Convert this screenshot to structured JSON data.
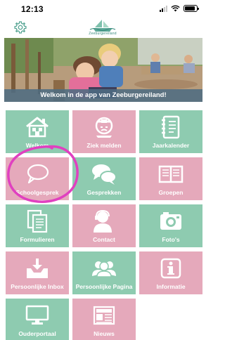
{
  "status_bar": {
    "time": "12:13",
    "battery_level": 0.9
  },
  "header": {
    "settings_icon": "gear-icon",
    "logo_subtitle": "Zeeburgereiland"
  },
  "hero": {
    "caption": "Welkom in de app van Zeeburgereiland!"
  },
  "tiles": [
    {
      "label": "Welkom",
      "icon": "house-icon",
      "color": "#8ecbb0"
    },
    {
      "label": "Ziek melden",
      "icon": "sick-face-icon",
      "color": "#e5a9bb"
    },
    {
      "label": "Jaarkalender",
      "icon": "calendar-icon",
      "color": "#8ecbb0"
    },
    {
      "label": "Schoolgesprek",
      "icon": "speech-bubble-icon",
      "color": "#e5a9bb"
    },
    {
      "label": "Gesprekken",
      "icon": "chat-bubbles-icon",
      "color": "#8ecbb0"
    },
    {
      "label": "Groepen",
      "icon": "book-icon",
      "color": "#e5a9bb"
    },
    {
      "label": "Formulieren",
      "icon": "documents-icon",
      "color": "#8ecbb0"
    },
    {
      "label": "Contact",
      "icon": "contact-person-icon",
      "color": "#e5a9bb"
    },
    {
      "label": "Foto's",
      "icon": "camera-icon",
      "color": "#8ecbb0"
    },
    {
      "label": "Persoonlijke Inbox",
      "icon": "inbox-icon",
      "color": "#e5a9bb"
    },
    {
      "label": "Persoonlijke Pagina",
      "icon": "people-icon",
      "color": "#8ecbb0"
    },
    {
      "label": "Informatie",
      "icon": "info-icon",
      "color": "#e5a9bb"
    },
    {
      "label": "Ouderportaal",
      "icon": "monitor-icon",
      "color": "#8ecbb0"
    },
    {
      "label": "Nieuws",
      "icon": "newspaper-icon",
      "color": "#e5a9bb"
    }
  ],
  "annotation": {
    "color": "#e040c0"
  }
}
